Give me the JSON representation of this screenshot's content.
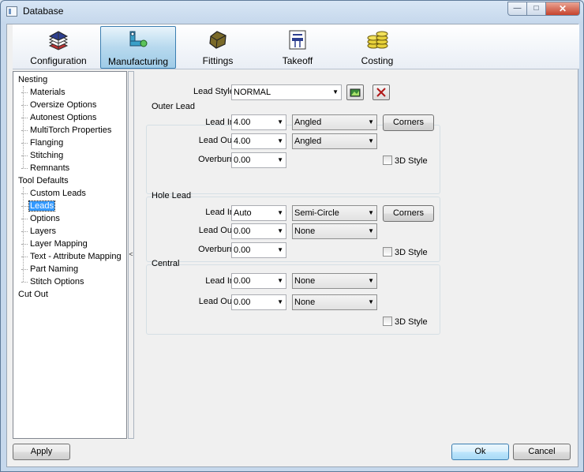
{
  "window": {
    "title": "Database"
  },
  "ribbon": {
    "tabs": [
      {
        "label": "Configuration",
        "icon": "book-stack-icon"
      },
      {
        "label": "Manufacturing",
        "icon": "pipe-tool-icon",
        "active": true
      },
      {
        "label": "Fittings",
        "icon": "fitting-shape-icon"
      },
      {
        "label": "Takeoff",
        "icon": "blueprint-icon"
      },
      {
        "label": "Costing",
        "icon": "coin-stack-icon"
      }
    ]
  },
  "tree": {
    "items": [
      {
        "label": "Nesting",
        "level": 0
      },
      {
        "label": "Materials",
        "level": 1
      },
      {
        "label": "Oversize Options",
        "level": 1
      },
      {
        "label": "Autonest Options",
        "level": 1
      },
      {
        "label": "MultiTorch Properties",
        "level": 1
      },
      {
        "label": "Flanging",
        "level": 1
      },
      {
        "label": "Stitching",
        "level": 1
      },
      {
        "label": "Remnants",
        "level": 1
      },
      {
        "label": "Tool Defaults",
        "level": 0
      },
      {
        "label": "Custom Leads",
        "level": 1
      },
      {
        "label": "Leads",
        "level": 1,
        "selected": true
      },
      {
        "label": "Options",
        "level": 1
      },
      {
        "label": "Layers",
        "level": 1
      },
      {
        "label": "Layer Mapping",
        "level": 1
      },
      {
        "label": "Text - Attribute Mapping",
        "level": 1
      },
      {
        "label": "Part Naming",
        "level": 1
      },
      {
        "label": "Stitch Options",
        "level": 1
      },
      {
        "label": "Cut Out",
        "level": 0
      }
    ]
  },
  "splitter": {
    "glyph": "<"
  },
  "leads": {
    "lead_style_label": "Lead Style",
    "lead_style_value": "NORMAL",
    "outer": {
      "title": "Outer Lead",
      "lead_in_label": "Lead In",
      "lead_in_value": "4.00",
      "lead_in_type": "Angled",
      "lead_out_label": "Lead Out",
      "lead_out_value": "4.00",
      "lead_out_type": "Angled",
      "overburn_label": "Overburn",
      "overburn_value": "0.00",
      "corners_label": "Corners",
      "style3d_label": "3D Style"
    },
    "hole": {
      "title": "Hole Lead",
      "lead_in_label": "Lead In",
      "lead_in_value": "Auto",
      "lead_in_type": "Semi-Circle",
      "lead_out_label": "Lead Out",
      "lead_out_value": "0.00",
      "lead_out_type": "None",
      "overburn_label": "Overburn",
      "overburn_value": "0.00",
      "corners_label": "Corners",
      "style3d_label": "3D Style"
    },
    "central": {
      "title": "Central",
      "lead_in_label": "Lead In",
      "lead_in_value": "0.00",
      "lead_in_type": "None",
      "lead_out_label": "Lead Out",
      "lead_out_value": "0.00",
      "lead_out_type": "None",
      "style3d_label": "3D Style"
    }
  },
  "footer": {
    "apply_label": "Apply",
    "ok_label": "Ok",
    "cancel_label": "Cancel"
  }
}
